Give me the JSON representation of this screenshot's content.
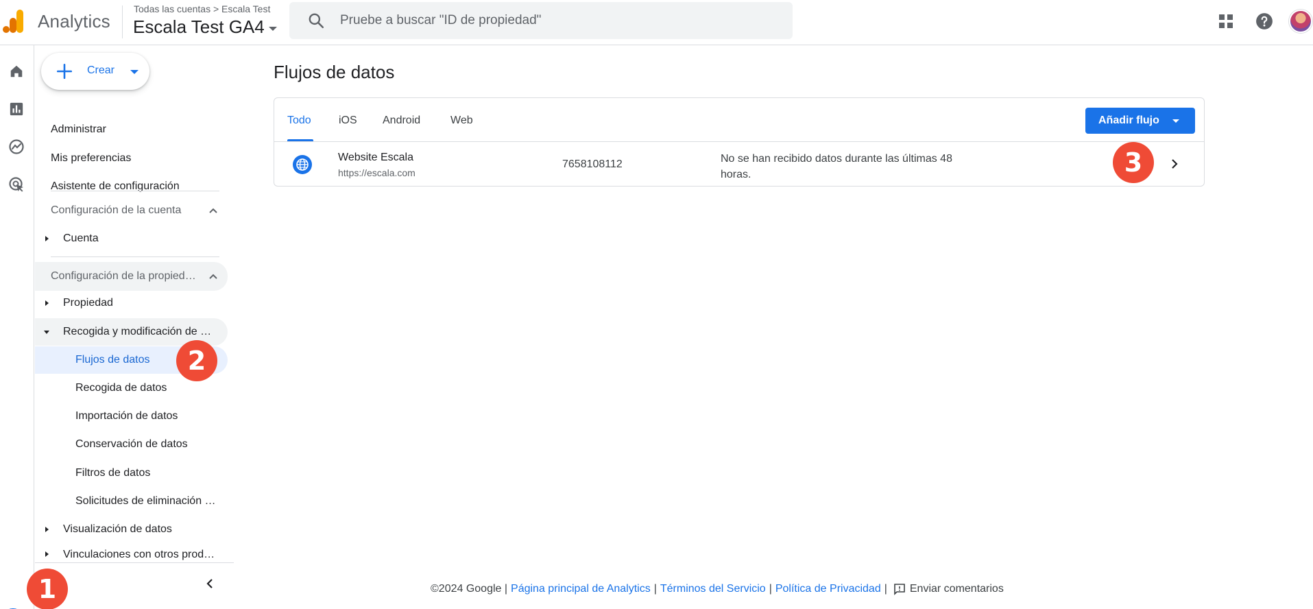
{
  "header": {
    "app_name": "Analytics",
    "breadcrumb": "Todas las cuentas > Escala Test",
    "property_name": "Escala Test GA4",
    "search_placeholder": "Pruebe a buscar \"ID de propiedad\"",
    "icons": [
      "apps-icon",
      "help-icon",
      "avatar"
    ]
  },
  "rail": {
    "icons": [
      "home-icon",
      "reports-icon",
      "explore-icon",
      "advertising-icon",
      "admin-gear-icon"
    ]
  },
  "nav": {
    "create_label": "Crear",
    "top_items": [
      "Administrar",
      "Mis preferencias",
      "Asistente de configuración"
    ],
    "account_section": "Configuración de la cuenta",
    "account_item": "Cuenta",
    "property_section": "Configuración de la propied…",
    "property_item": "Propiedad",
    "data_collection_group": "Recogida y modificación de …",
    "data_items": [
      "Flujos de datos",
      "Recogida de datos",
      "Importación de datos",
      "Conservación de datos",
      "Filtros de datos",
      "Solicitudes de eliminación …"
    ],
    "data_display": "Visualización de datos",
    "product_links": "Vinculaciones con otros prod…"
  },
  "main": {
    "title": "Flujos de datos",
    "tabs": [
      "Todo",
      "iOS",
      "Android",
      "Web"
    ],
    "active_tab": "Todo",
    "add_button": "Añadir flujo",
    "stream": {
      "name": "Website Escala",
      "url": "https://escala.com",
      "id": "7658108112",
      "status": "No se han recibido datos durante las últimas 48 horas."
    }
  },
  "badges": [
    "1",
    "2",
    "3"
  ],
  "footer": {
    "copyright": "©2024 Google |",
    "link_home": "Página principal de Analytics",
    "sep1": "|",
    "link_terms": "Términos del Servicio",
    "sep2": "|",
    "link_privacy": "Política de Privacidad",
    "sep3": "|",
    "feedback": "Enviar comentarios"
  },
  "colors": {
    "accent": "#1a73e8",
    "badge": "#ef4b36",
    "active_nav_bg": "#e8f0fe",
    "logo_orange": "#f9ab00",
    "logo_dark_orange": "#e37400"
  }
}
